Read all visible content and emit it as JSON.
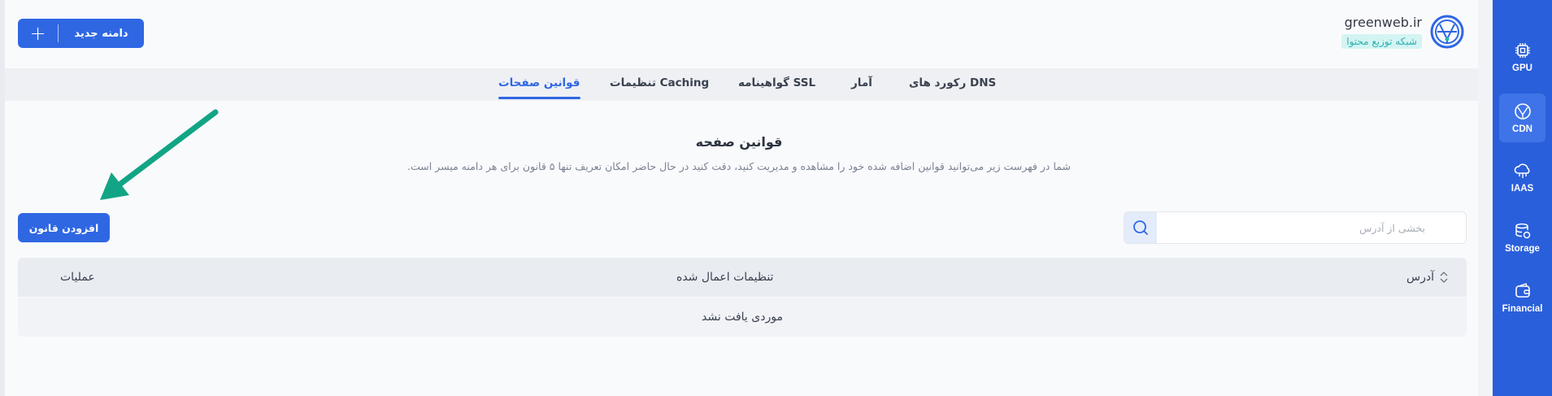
{
  "brand": {
    "name": "greenweb.ir",
    "badge": "شبکه توزیع محتوا"
  },
  "header": {
    "new_domain_label": "دامنه جدید"
  },
  "tabs": [
    {
      "label": "رکورد های DNS"
    },
    {
      "label": "آمار"
    },
    {
      "label": "گواهینامه SSL"
    },
    {
      "label": "تنظیمات Caching"
    },
    {
      "label": "قوانین صفحات",
      "active": true
    }
  ],
  "section": {
    "title": "قوانین صفحه",
    "description": "شما در فهرست زیر می‌توانید قوانین اضافه شده خود را مشاهده و مدیریت کنید، دقت کنید در حال حاضر امکان تعریف تنها ۵ قانون برای هر دامنه میسر است."
  },
  "toolbar": {
    "add_rule_label": "افزودن قانون",
    "search_placeholder": "بخشی از آدرس"
  },
  "table": {
    "columns": [
      "آدرس",
      "تنظیمات اعمال شده",
      "عملیات"
    ],
    "empty_text": "موردی یافت نشد"
  },
  "sidebar": {
    "items": [
      {
        "label": "GPU",
        "icon": "chip-icon"
      },
      {
        "label": "CDN",
        "icon": "globe-icon",
        "active": true
      },
      {
        "label": "IAAS",
        "icon": "cloud-icon"
      },
      {
        "label": "Storage",
        "icon": "database-icon"
      },
      {
        "label": "Financial",
        "icon": "wallet-icon"
      }
    ]
  },
  "colors": {
    "primary": "#2f67e3",
    "sidebar": "#2a5fdb",
    "badge_bg": "#d4f4f3",
    "badge_text": "#2bb2b0",
    "annotation_arrow": "#12a585"
  }
}
